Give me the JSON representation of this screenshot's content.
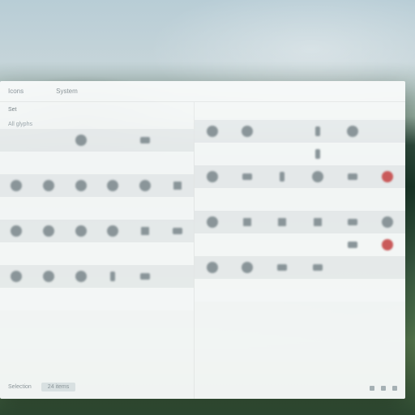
{
  "header": {
    "title": "Icons",
    "category": "System"
  },
  "left_panel": {
    "heading": "Set",
    "sub": "All glyphs",
    "rows": [
      [
        "",
        "",
        "circle",
        "",
        "bar",
        ""
      ],
      [
        "",
        "",
        "",
        "",
        "",
        ""
      ],
      [
        "round",
        "round",
        "round",
        "round",
        "round",
        "grid"
      ],
      [
        "",
        "",
        "",
        "",
        "",
        ""
      ],
      [
        "round",
        "round",
        "round",
        "round",
        "grid",
        "bar"
      ],
      [
        "",
        "",
        "",
        "",
        "",
        ""
      ],
      [
        "round",
        "round",
        "round",
        "tall",
        "bar",
        ""
      ],
      [
        "",
        "",
        "",
        "",
        "",
        ""
      ]
    ],
    "footer": {
      "label": "Selection",
      "chip": "24 items"
    }
  },
  "right_panel": {
    "heading": " ",
    "rows": [
      [
        "round",
        "round",
        "",
        "tall",
        "round",
        ""
      ],
      [
        "",
        "",
        "",
        "tall",
        "",
        ""
      ],
      [
        "round",
        "bar",
        "tall",
        "round",
        "bar",
        "red"
      ],
      [
        "",
        "",
        "",
        "",
        "",
        ""
      ],
      [
        "round",
        "grid",
        "grid",
        "grid",
        "bar",
        "round"
      ],
      [
        "",
        "",
        "",
        "",
        "bar",
        "red"
      ],
      [
        "round",
        "round",
        "bar",
        "bar",
        "",
        ""
      ],
      [
        "",
        "",
        "",
        "",
        "",
        ""
      ]
    ],
    "footer_count": "—"
  }
}
